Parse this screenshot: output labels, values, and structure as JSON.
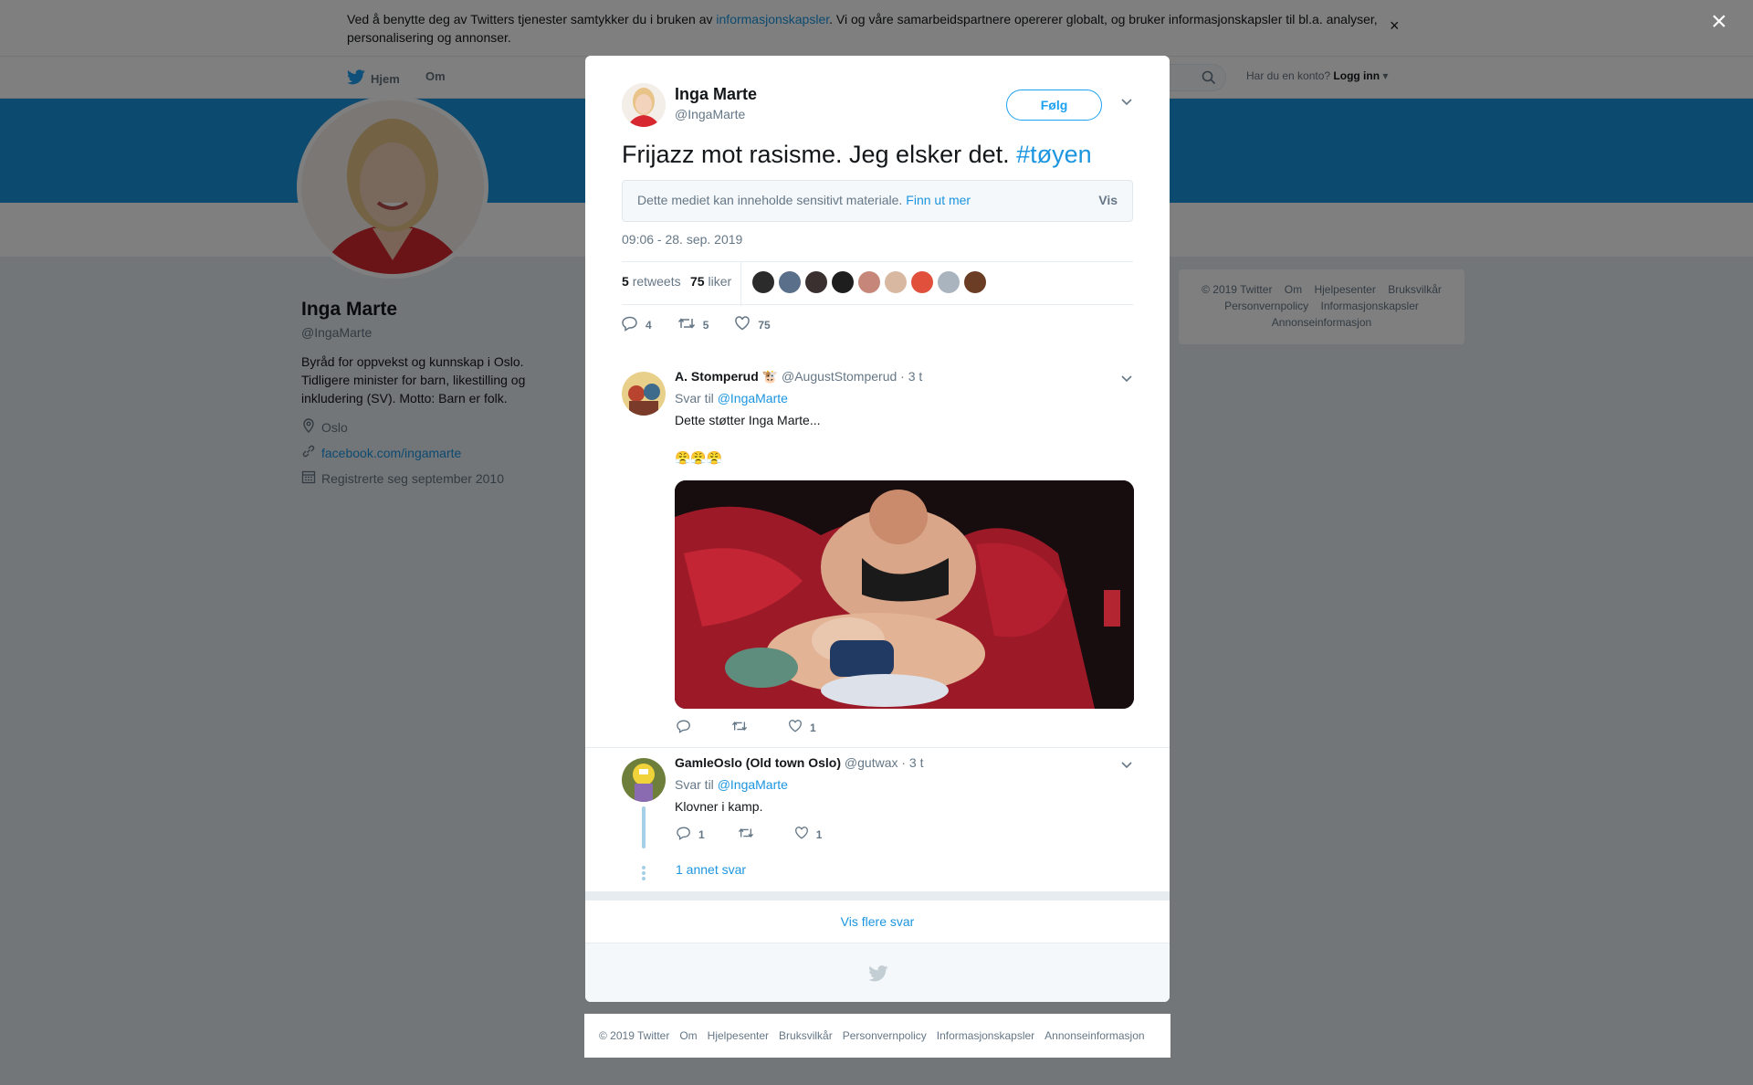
{
  "cookie_bar": {
    "text_before": "Ved å benytte deg av Twitters tjenester samtykker du i bruken av ",
    "link": "informasjonskapsler",
    "text_after": ". Vi og våre samarbeidspartnere opererer globalt, og bruker informasjonskapsler til bl.a. analyser, personalisering og annonser.",
    "close": "×"
  },
  "topnav": {
    "home": "Hjem",
    "about": "Om",
    "login_prompt": "Har du en konto?",
    "login": "Logg inn"
  },
  "profile": {
    "name": "Inga Marte",
    "handle": "@IngaMarte",
    "bio": "Byråd for oppvekst og kunnskap i Oslo. Tidligere minister for barn, likestilling og inkludering (SV). Motto: Barn er folk.",
    "location": "Oslo",
    "website": "facebook.com/ingamarte",
    "joined": "Registrerte seg september 2010"
  },
  "side_footer": [
    "© 2019 Twitter",
    "Om",
    "Hjelpesenter",
    "Bruksvilkår",
    "Personvernpolicy",
    "Informasjonskapsler",
    "Annonseinformasjon"
  ],
  "modal": {
    "close": "×",
    "author_name": "Inga Marte",
    "author_handle": "@IngaMarte",
    "follow": "Følg",
    "tweet_text": "Frijazz mot rasisme. Jeg elsker det. ",
    "hashtag": "#tøyen",
    "sensitive_text": "Dette mediet kan inneholde sensitivt materiale.",
    "sensitive_link": "Finn ut mer",
    "sensitive_show": "Vis",
    "timestamp": "09:06 - 28. sep. 2019",
    "retweets_count": "5",
    "retweets_label": "retweets",
    "likes_count": "75",
    "likes_label": "liker",
    "action_replies": "4",
    "action_retweets": "5",
    "action_likes": "75",
    "liker_colors": [
      "#2b2b2b",
      "#5a6f8a",
      "#3b3030",
      "#1e1e1e",
      "#c7867a",
      "#d8b8a0",
      "#e0503a",
      "#a9b4bf",
      "#6b3d24"
    ]
  },
  "replies": [
    {
      "name": "A. Stomperud",
      "emoji": "🐮",
      "handle": "@AugustStomperud",
      "time": "· 3 t",
      "reply_to_label": "Svar til",
      "reply_to": "@IngaMarte",
      "text": "Dette støtter Inga Marte...",
      "emoji_line": "😤😤😤",
      "replies": "",
      "retweets": "",
      "likes": "1"
    },
    {
      "name": "GamleOslo (Old town Oslo)",
      "emoji": "",
      "handle": "@gutwax",
      "time": "· 3 t",
      "reply_to_label": "Svar til",
      "reply_to": "@IngaMarte",
      "text": "Klovner i kamp.",
      "emoji_line": "",
      "replies": "1",
      "retweets": "",
      "likes": "1"
    }
  ],
  "more_replies": "1 annet svar",
  "show_more": "Vis flere svar",
  "bottom_footer": [
    "© 2019 Twitter",
    "Om",
    "Hjelpesenter",
    "Bruksvilkår",
    "Personvernpolicy",
    "Informasjonskapsler",
    "Annonseinformasjon"
  ],
  "colors": {
    "accent": "#1b95e0",
    "banner": "#1b95e0",
    "overlay": "rgba(0,0,0,0.5)"
  },
  "icons": [
    "twitter-bird-icon",
    "search-icon",
    "location-icon",
    "link-icon",
    "calendar-icon",
    "chevron-down-icon",
    "reply-icon",
    "retweet-icon",
    "like-icon",
    "close-icon"
  ]
}
